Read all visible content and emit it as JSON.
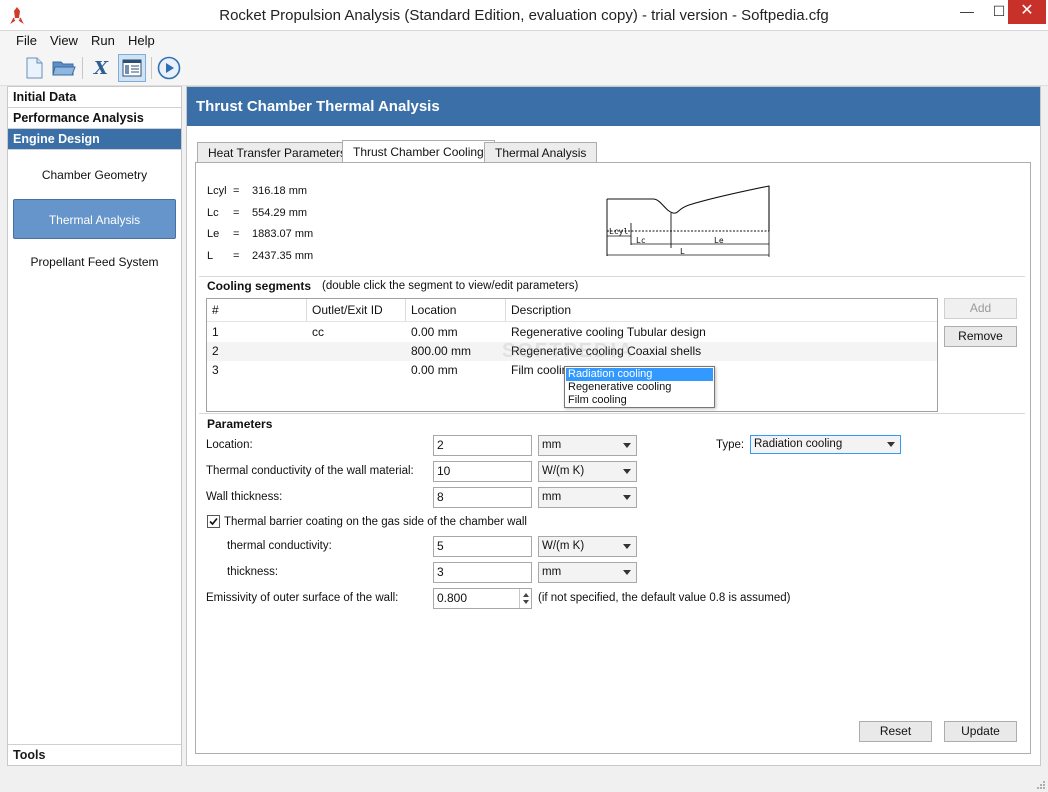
{
  "window": {
    "title": "Rocket Propulsion Analysis (Standard Edition, evaluation copy) - trial version - Softpedia.cfg",
    "min_glyph": "—",
    "max_glyph": "☐",
    "close_glyph": "✕"
  },
  "menu": {
    "items": [
      "File",
      "View",
      "Run",
      "Help"
    ]
  },
  "toolbar": {
    "buttons": [
      "new-file",
      "open-folder",
      "formula",
      "report",
      "run"
    ],
    "formula_glyph": "X"
  },
  "sidebar": {
    "sections": [
      "Initial Data",
      "Performance Analysis",
      "Engine Design"
    ],
    "items": [
      "Chamber Geometry",
      "Thermal Analysis",
      "Propellant Feed System"
    ],
    "tools": "Tools"
  },
  "main": {
    "title": "Thrust Chamber Thermal Analysis"
  },
  "tabs": [
    "Heat Transfer Parameters",
    "Thrust Chamber Cooling",
    "Thermal Analysis"
  ],
  "dimensions": [
    {
      "key": "Lcyl",
      "eq": "=",
      "value": "316.18 mm"
    },
    {
      "key": "Lc",
      "eq": "=",
      "value": "554.29 mm"
    },
    {
      "key": "Le",
      "eq": "=",
      "value": "1883.07 mm"
    },
    {
      "key": "L",
      "eq": "=",
      "value": "2437.35 mm"
    }
  ],
  "diagram": {
    "lcyl": "Lcyl",
    "lc": "Lc",
    "le": "Le",
    "l": "L"
  },
  "segments": {
    "title": "Cooling segments",
    "hint": "(double click the segment to view/edit parameters)",
    "columns": [
      "#",
      "Outlet/Exit ID",
      "Location",
      "Description"
    ],
    "rows": [
      [
        "1",
        "cc",
        "0.00 mm",
        "Regenerative cooling Tubular design"
      ],
      [
        "2",
        "",
        "800.00 mm",
        "Regenerative cooling Coaxial shells"
      ],
      [
        "3",
        "",
        "0.00 mm",
        "Film cooling"
      ]
    ],
    "add_label": "Add",
    "remove_label": "Remove"
  },
  "parameters": {
    "title": "Parameters",
    "location": {
      "label": "Location:",
      "value": "2",
      "unit": "mm"
    },
    "conductivity": {
      "label": "Thermal conductivity of the wall material:",
      "value": "10",
      "unit": "W/(m K)"
    },
    "thickness": {
      "label": "Wall thickness:",
      "value": "8",
      "unit": "mm"
    },
    "tbc": {
      "label": "Thermal barrier coating on the gas side of the chamber wall",
      "checked": true,
      "conductivity": {
        "label": "thermal conductivity:",
        "value": "5",
        "unit": "W/(m K)"
      },
      "thickness": {
        "label": "thickness:",
        "value": "3",
        "unit": "mm"
      }
    },
    "emissivity": {
      "label": "Emissivity of outer surface of the wall:",
      "value": "0.800",
      "note": "(if not specified, the default value 0.8 is assumed)"
    },
    "type": {
      "label": "Type:",
      "value": "Radiation cooling",
      "options": [
        "Radiation cooling",
        "Regenerative cooling",
        "Film cooling"
      ]
    }
  },
  "footer": {
    "reset_label": "Reset",
    "update_label": "Update"
  },
  "watermark": "SOFTPEDIA",
  "colors": {
    "accent": "#3a6fa8",
    "nav_active": "#6595cb",
    "select_highlight": "#3399ff",
    "close": "#c7312a"
  }
}
